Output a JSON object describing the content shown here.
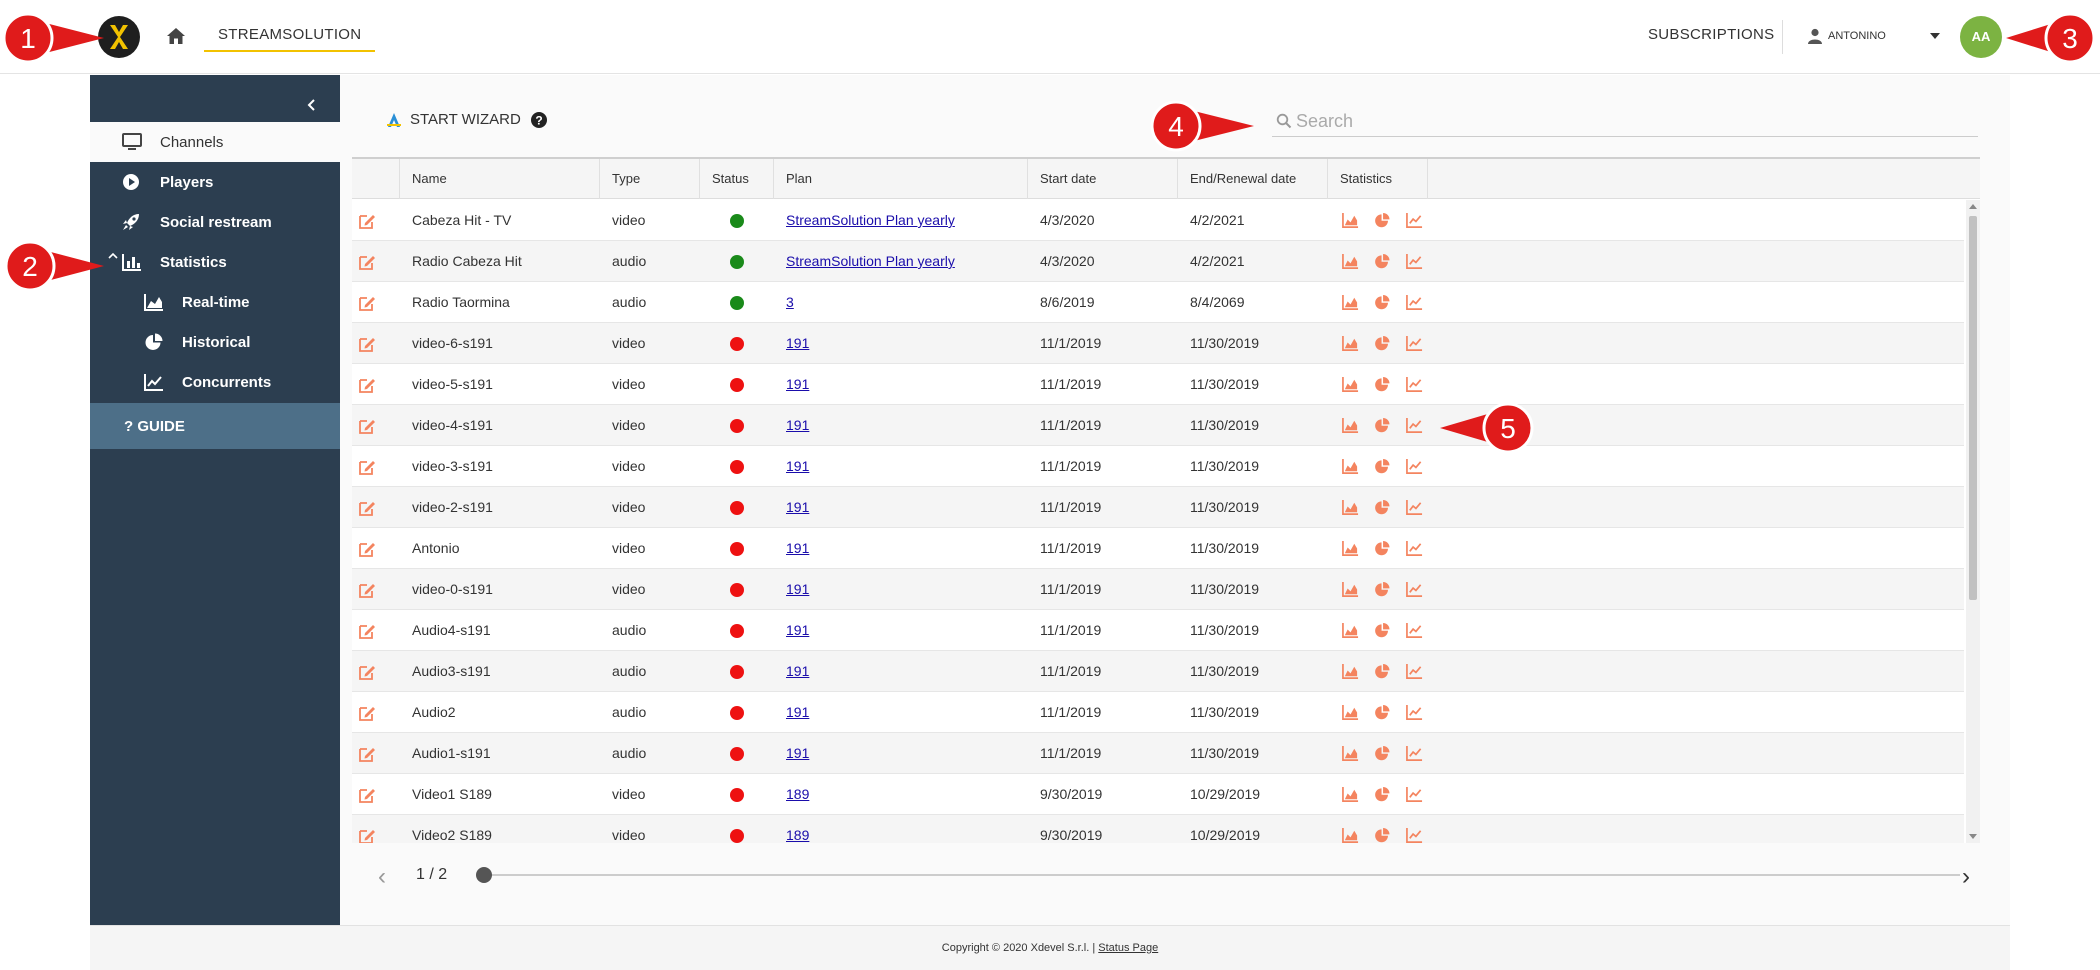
{
  "header": {
    "brand_tab": "STREAMSOLUTION",
    "subscriptions": "SUBSCRIPTIONS",
    "user_name": "ANTONINO",
    "avatar_initials": "AA"
  },
  "sidebar": {
    "items": [
      {
        "label": "Channels",
        "icon": "monitor-icon"
      },
      {
        "label": "Players",
        "icon": "play-icon"
      },
      {
        "label": "Social restream",
        "icon": "rocket-icon"
      },
      {
        "label": "Statistics",
        "icon": "bar-chart-icon"
      },
      {
        "label": "Real-time",
        "icon": "area-chart-icon"
      },
      {
        "label": "Historical",
        "icon": "pie-chart-icon"
      },
      {
        "label": "Concurrents",
        "icon": "line-chart-icon"
      }
    ],
    "guide": "GUIDE"
  },
  "toolbar": {
    "wizard_label": "START WIZARD",
    "search_placeholder": "Search"
  },
  "table": {
    "columns": [
      "Name",
      "Type",
      "Status",
      "Plan",
      "Start date",
      "End/Renewal date",
      "Statistics"
    ],
    "rows": [
      {
        "name": "Cabeza Hit - TV",
        "type": "video",
        "status": "active",
        "plan": "StreamSolution Plan yearly",
        "start": "4/3/2020",
        "end": "4/2/2021"
      },
      {
        "name": "Radio Cabeza Hit",
        "type": "audio",
        "status": "active",
        "plan": "StreamSolution Plan yearly",
        "start": "4/3/2020",
        "end": "4/2/2021"
      },
      {
        "name": "Radio Taormina",
        "type": "audio",
        "status": "active",
        "plan": "3",
        "start": "8/6/2019",
        "end": "8/4/2069"
      },
      {
        "name": "video-6-s191",
        "type": "video",
        "status": "inactive",
        "plan": "191",
        "start": "11/1/2019",
        "end": "11/30/2019"
      },
      {
        "name": "video-5-s191",
        "type": "video",
        "status": "inactive",
        "plan": "191",
        "start": "11/1/2019",
        "end": "11/30/2019"
      },
      {
        "name": "video-4-s191",
        "type": "video",
        "status": "inactive",
        "plan": "191",
        "start": "11/1/2019",
        "end": "11/30/2019"
      },
      {
        "name": "video-3-s191",
        "type": "video",
        "status": "inactive",
        "plan": "191",
        "start": "11/1/2019",
        "end": "11/30/2019"
      },
      {
        "name": "video-2-s191",
        "type": "video",
        "status": "inactive",
        "plan": "191",
        "start": "11/1/2019",
        "end": "11/30/2019"
      },
      {
        "name": "Antonio",
        "type": "video",
        "status": "inactive",
        "plan": "191",
        "start": "11/1/2019",
        "end": "11/30/2019"
      },
      {
        "name": "video-0-s191",
        "type": "video",
        "status": "inactive",
        "plan": "191",
        "start": "11/1/2019",
        "end": "11/30/2019"
      },
      {
        "name": "Audio4-s191",
        "type": "audio",
        "status": "inactive",
        "plan": "191",
        "start": "11/1/2019",
        "end": "11/30/2019"
      },
      {
        "name": "Audio3-s191",
        "type": "audio",
        "status": "inactive",
        "plan": "191",
        "start": "11/1/2019",
        "end": "11/30/2019"
      },
      {
        "name": "Audio2",
        "type": "audio",
        "status": "inactive",
        "plan": "191",
        "start": "11/1/2019",
        "end": "11/30/2019"
      },
      {
        "name": "Audio1-s191",
        "type": "audio",
        "status": "inactive",
        "plan": "191",
        "start": "11/1/2019",
        "end": "11/30/2019"
      },
      {
        "name": "Video1 S189",
        "type": "video",
        "status": "inactive",
        "plan": "189",
        "start": "9/30/2019",
        "end": "10/29/2019"
      },
      {
        "name": "Video2 S189",
        "type": "video",
        "status": "inactive",
        "plan": "189",
        "start": "9/30/2019",
        "end": "10/29/2019"
      }
    ]
  },
  "pager": {
    "text": "1 / 2"
  },
  "footer": {
    "copyright": "Copyright © 2020 Xdevel S.r.l. |",
    "status_link": "Status Page"
  },
  "callouts": [
    "1",
    "2",
    "3",
    "4",
    "5"
  ],
  "colors": {
    "sidebar": "#2c3e50",
    "guide": "#4d6f88",
    "accent": "#f2c200",
    "icon_orange": "#f4845f",
    "status_active": "#1a8a1a",
    "status_inactive": "#ee1111",
    "callout_red": "#e01b1b",
    "avatar": "#7cb342"
  }
}
